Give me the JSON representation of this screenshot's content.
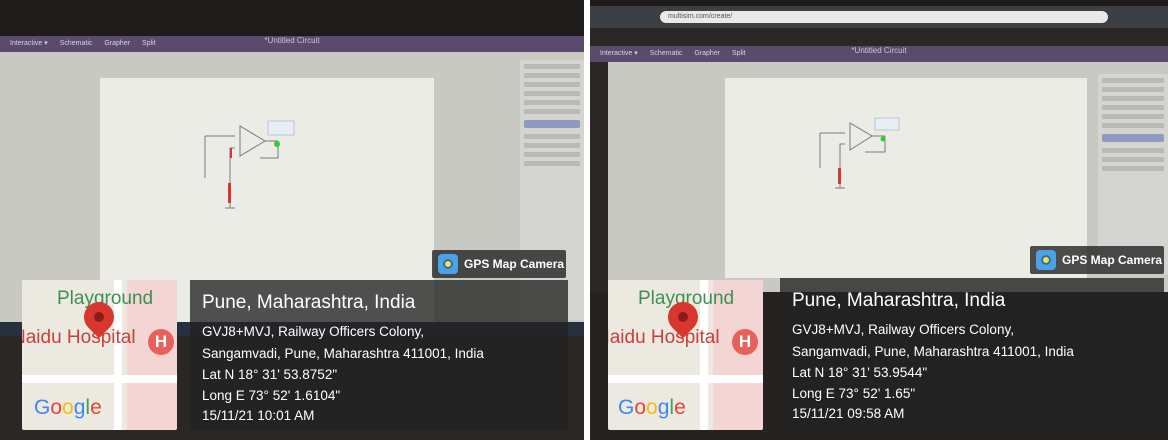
{
  "photos": [
    {
      "screen": {
        "window_title": "*Untitled Circuit",
        "toolbar_items": [
          "Interactive ▾",
          "Schematic",
          "Grapher",
          "Split"
        ]
      },
      "overlay": {
        "badge_label": "GPS Map Camera",
        "city": "Pune, Maharashtra, India",
        "address_line1": "GVJ8+MVJ, Railway Officers Colony,",
        "address_line2": "Sangamvadi, Pune, Maharashtra 411001, India",
        "latitude": "Lat N 18° 31' 53.8752\"",
        "longitude": "Long E 73° 52' 1.6104\"",
        "datetime": "15/11/21 10:01 AM"
      },
      "map": {
        "label_top": "Playground",
        "label_hospital": "Naidu Hospital",
        "hospital_marker": "H",
        "logo": [
          "G",
          "o",
          "o",
          "g",
          "l",
          "e"
        ]
      }
    },
    {
      "screen": {
        "window_title": "*Untitled Circuit",
        "url": "multisim.com/create/",
        "toolbar_items": [
          "Interactive ▾",
          "Schematic",
          "Grapher",
          "Split"
        ]
      },
      "overlay": {
        "badge_label": "GPS Map Camera",
        "city": "Pune, Maharashtra, India",
        "address_line1": "GVJ8+MVJ, Railway Officers Colony,",
        "address_line2": "Sangamvadi, Pune, Maharashtra 411001, India",
        "latitude": "Lat N 18° 31' 53.9544\"",
        "longitude": "Long E 73° 52' 1.65\"",
        "datetime": "15/11/21 09:58 AM"
      },
      "map": {
        "label_top": "Playground",
        "label_hospital": "Naidu Hospital",
        "hospital_marker": "H",
        "logo": [
          "G",
          "o",
          "o",
          "g",
          "l",
          "e"
        ]
      }
    }
  ],
  "icons": {
    "badge": "gps-camera-icon",
    "pin": "map-pin-icon",
    "hospital": "hospital-marker-icon"
  },
  "colors": {
    "overlay_bg": "#232323",
    "pin": "#d9362e",
    "map_green_label": "#3d8f54",
    "hospital_red": "#e8605a"
  }
}
